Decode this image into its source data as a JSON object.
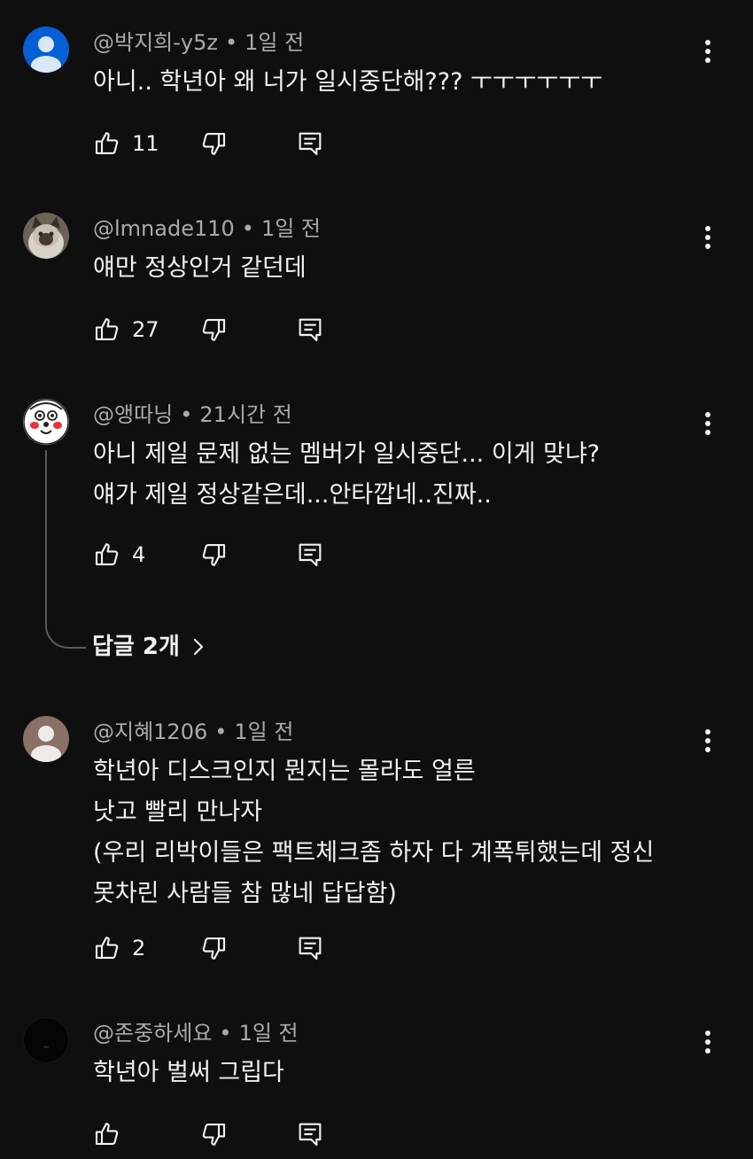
{
  "comments": [
    {
      "author": "@박지희-y5z",
      "time": "1일 전",
      "lines": [
        "아니.. 학년아 왜 너가 일시중단해??? ㅜㅜㅜㅜㅜㅜ"
      ],
      "likes": "11",
      "avatar": "default-blue"
    },
    {
      "author": "@lmnade110",
      "time": "1일 전",
      "lines": [
        "얘만 정상인거 같던데"
      ],
      "likes": "27",
      "avatar": "cat-photo"
    },
    {
      "author": "@앵따닝",
      "time": "21시간 전",
      "lines": [
        "아니 제일 문제 없는 멤버가 일시중단... 이게 맞냐?",
        "얘가 제일 정상같은데...안타깝네..진짜.."
      ],
      "likes": "4",
      "avatar": "cartoon-face",
      "replies_label": "답글 2개"
    },
    {
      "author": "@지혜1206",
      "time": "1일 전",
      "lines": [
        "학년아 디스크인지 뭔지는 몰라도 얼른",
        "낫고 빨리 만나자",
        "(우리 리박이들은 팩트체크좀 하자 다 계폭튀했는데 정신",
        "못차린 사람들 참 많네 답답함)"
      ],
      "likes": "2",
      "avatar": "default-gray"
    },
    {
      "author": "@존중하세요",
      "time": "1일 전",
      "lines": [
        "학년아 벌써 그립다"
      ],
      "likes": "",
      "avatar": "black"
    }
  ],
  "separator": "•",
  "icons": [
    "thumbs-up-icon",
    "thumbs-down-icon",
    "reply-icon",
    "more-vert-icon",
    "chevron-right-icon"
  ],
  "colors": {
    "background": "#0f0f0f",
    "text": "#f1f1f1",
    "secondary": "#aaaaaa",
    "blue_avatar": "#065fd4"
  }
}
